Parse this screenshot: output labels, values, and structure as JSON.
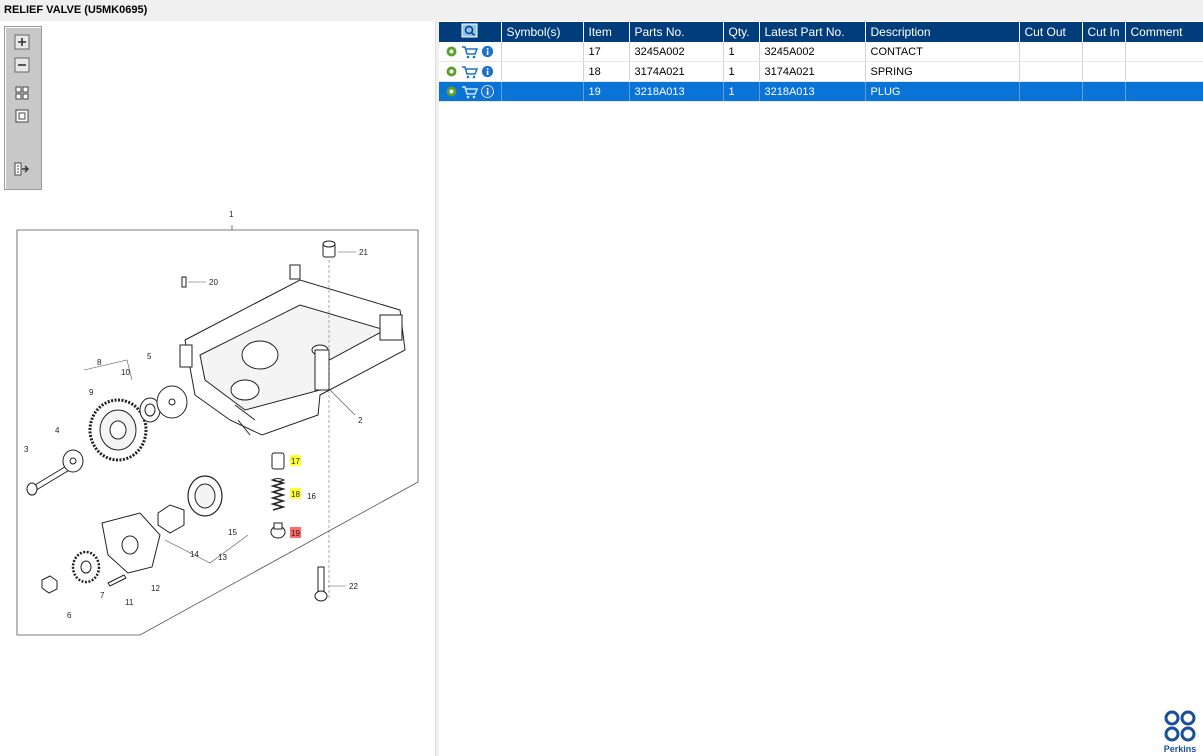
{
  "title": "RELIEF VALVE (U5MK0695)",
  "toolbar": {
    "zoom_in": "zoom-in",
    "zoom_out": "zoom-out",
    "fit": "fit-all",
    "actual": "actual-size",
    "export": "export"
  },
  "table": {
    "headers": [
      "",
      "Symbol(s)",
      "Item",
      "Parts No.",
      "Qty.",
      "Latest Part No.",
      "Description",
      "Cut Out",
      "Cut In",
      "Comment"
    ],
    "rows": [
      {
        "symbols": "",
        "item": "17",
        "part_no": "3245A002",
        "qty": "1",
        "latest": "3245A002",
        "description": "CONTACT",
        "cut_out": "",
        "cut_in": "",
        "comment": "",
        "selected": false
      },
      {
        "symbols": "",
        "item": "18",
        "part_no": "3174A021",
        "qty": "1",
        "latest": "3174A021",
        "description": "SPRING",
        "cut_out": "",
        "cut_in": "",
        "comment": "",
        "selected": false
      },
      {
        "symbols": "",
        "item": "19",
        "part_no": "3218A013",
        "qty": "1",
        "latest": "3218A013",
        "description": "PLUG",
        "cut_out": "",
        "cut_in": "",
        "comment": "",
        "selected": true
      }
    ]
  },
  "diagram": {
    "callouts": [
      "1",
      "2",
      "3",
      "4",
      "5",
      "6",
      "7",
      "8",
      "9",
      "10",
      "11",
      "12",
      "13",
      "14",
      "15",
      "16",
      "17",
      "18",
      "19",
      "20",
      "21",
      "22"
    ],
    "highlight_yellow": [
      "17",
      "18"
    ],
    "highlight_red": [
      "19"
    ]
  },
  "brand": {
    "name": "Perkins",
    "color": "#1a4f9c"
  },
  "colors": {
    "header_bg": "#003d7a",
    "selected_row": "#0a74d6",
    "action_green": "#5aa02c",
    "action_blue": "#1e73c8"
  }
}
